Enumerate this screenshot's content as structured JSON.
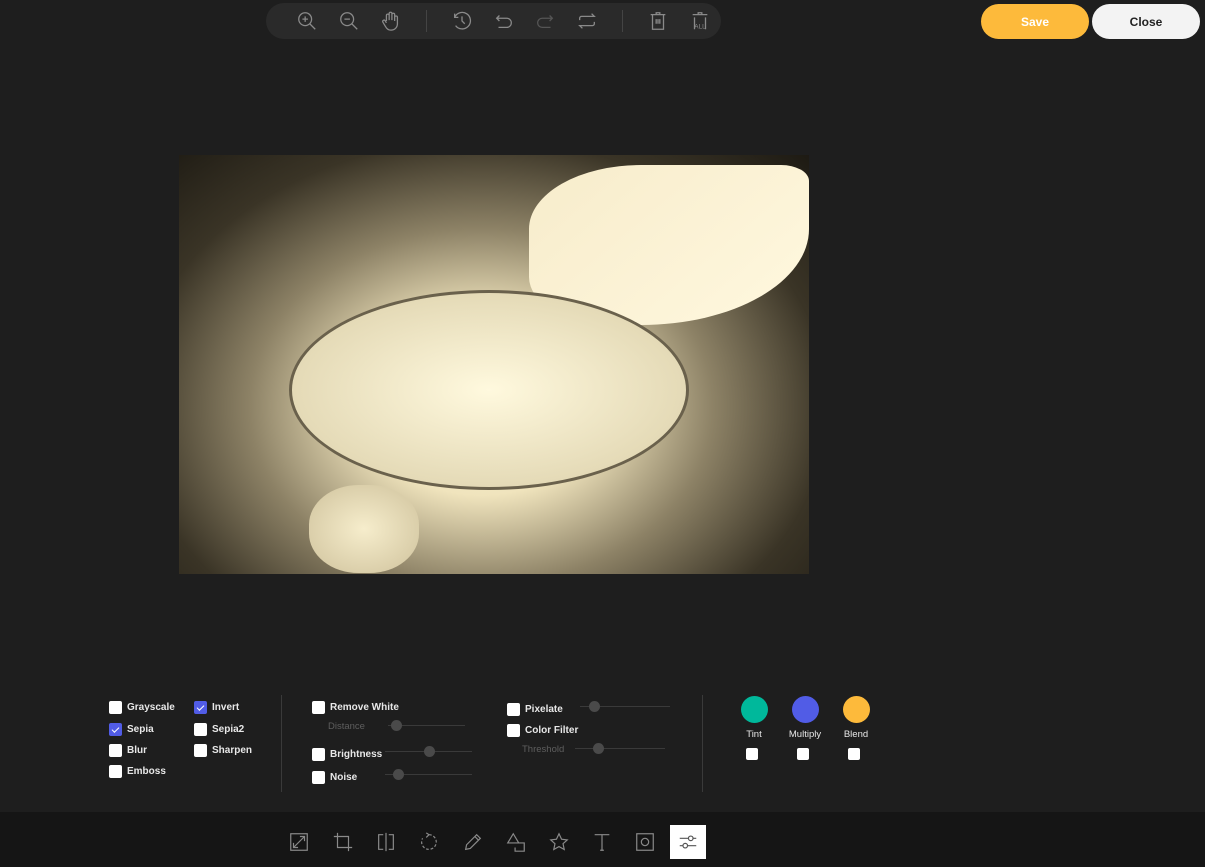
{
  "toolbar": {
    "icons": [
      "zoom-in",
      "zoom-out",
      "hand",
      "history",
      "undo",
      "redo",
      "reset",
      "delete",
      "delete-all"
    ],
    "delete_all_label": "ALL"
  },
  "header": {
    "save_label": "Save",
    "close_label": "Close"
  },
  "colors": {
    "save": "#fdba3b",
    "checked": "#515ce6",
    "tint": "#00b89b",
    "multiply": "#515ce6",
    "blend": "#fdba3b"
  },
  "filters": {
    "grayscale": {
      "label": "Grayscale",
      "checked": false
    },
    "invert": {
      "label": "Invert",
      "checked": true
    },
    "sepia": {
      "label": "Sepia",
      "checked": true
    },
    "sepia2": {
      "label": "Sepia2",
      "checked": false
    },
    "blur": {
      "label": "Blur",
      "checked": false
    },
    "sharpen": {
      "label": "Sharpen",
      "checked": false
    },
    "emboss": {
      "label": "Emboss",
      "checked": false
    },
    "remove_white": {
      "label": "Remove White",
      "checked": false,
      "distance_label": "Distance",
      "distance_value": 0.1
    },
    "brightness": {
      "label": "Brightness",
      "checked": false,
      "value": 0.5
    },
    "noise": {
      "label": "Noise",
      "checked": false,
      "value": 0.15
    },
    "pixelate": {
      "label": "Pixelate",
      "checked": false,
      "value": 0.15
    },
    "color_filter": {
      "label": "Color Filter",
      "checked": false,
      "threshold_label": "Threshold",
      "threshold_value": 0.25
    },
    "tint": {
      "label": "Tint",
      "checked": false
    },
    "multiply": {
      "label": "Multiply",
      "checked": false
    },
    "blend": {
      "label": "Blend",
      "checked": false
    }
  },
  "menu": {
    "items": [
      "resize",
      "crop",
      "flip",
      "rotate",
      "draw",
      "shape",
      "icon",
      "text",
      "mask",
      "filter"
    ],
    "active": "filter"
  }
}
